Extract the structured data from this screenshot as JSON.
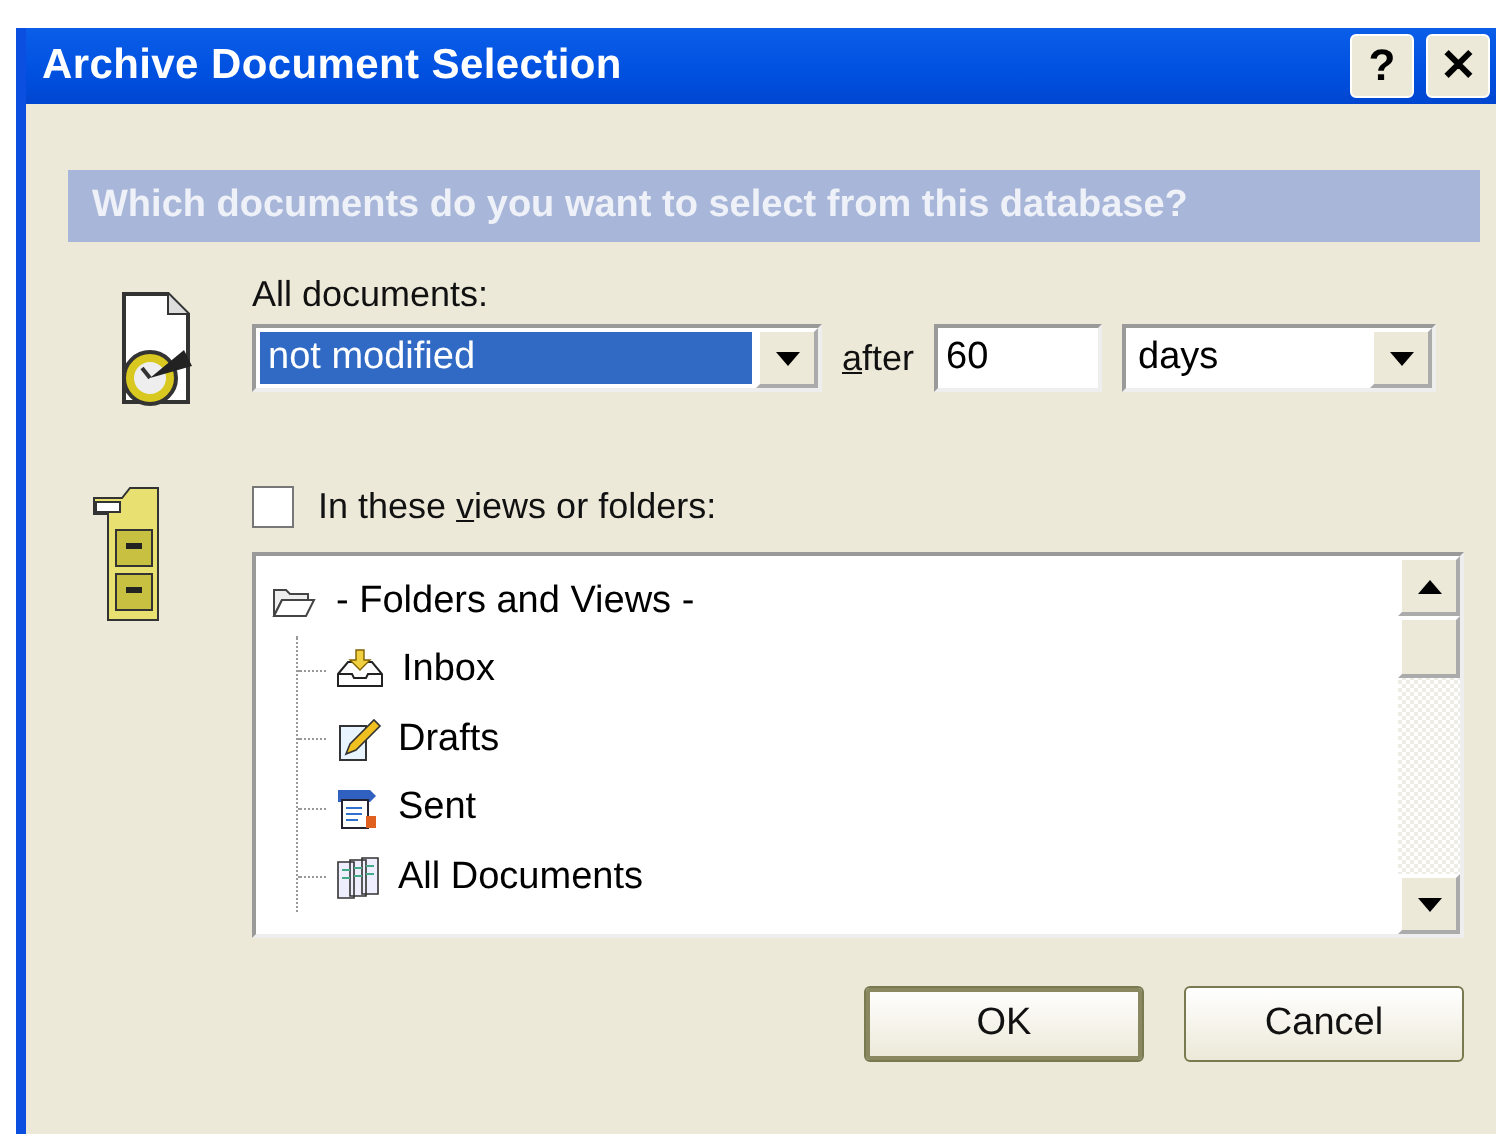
{
  "window": {
    "title": "Archive Document Selection",
    "help_button": "?",
    "close_button": "✕"
  },
  "banner": "Which documents do you want to select from this database?",
  "criteria": {
    "label": "All documents:",
    "condition": {
      "value": "not modified",
      "selected": true
    },
    "after_label": [
      {
        "text": "a",
        "access_key": true
      },
      {
        "text": "fter",
        "access_key": false
      }
    ],
    "amount": "60",
    "unit": "days"
  },
  "folders": {
    "checkbox": {
      "label": [
        {
          "text": "In these ",
          "access_key": false
        },
        {
          "text": "v",
          "access_key": true
        },
        {
          "text": "iews or folders:",
          "access_key": false
        }
      ],
      "checked": false
    },
    "tree": {
      "label": "- Folders and Views -",
      "expanded": true,
      "children": [
        {
          "label": "Inbox",
          "kind": "inbox"
        },
        {
          "label": "Drafts",
          "kind": "drafts"
        },
        {
          "label": "Sent",
          "kind": "sent"
        },
        {
          "label": "All Documents",
          "kind": "documents"
        }
      ]
    }
  },
  "buttons": [
    {
      "label": "OK",
      "default": true
    },
    {
      "label": "Cancel",
      "default": false
    }
  ]
}
